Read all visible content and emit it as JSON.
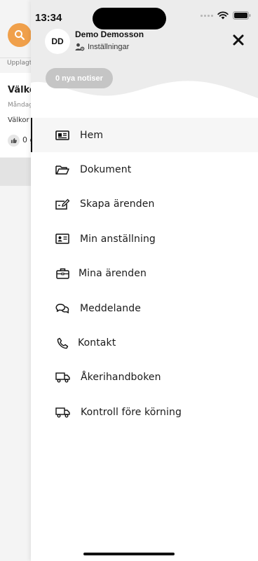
{
  "background": {
    "section_label": "Upplagt",
    "post_title": "Välko",
    "post_date": "Måndag",
    "post_text": "Välkor",
    "like_count": "0 g"
  },
  "status_bar": {
    "time": "13:34"
  },
  "drawer": {
    "avatar_initials": "DD",
    "user_name": "Demo Demosson",
    "settings_label": "Inställningar",
    "notifications_label": "0 nya notiser",
    "menu": [
      {
        "label": "Hem",
        "icon": "home-news-icon",
        "active": true
      },
      {
        "label": "Dokument",
        "icon": "folder-icon",
        "active": false
      },
      {
        "label": "Skapa ärenden",
        "icon": "edit-ticket-icon",
        "active": false
      },
      {
        "label": "Min anställning",
        "icon": "id-card-icon",
        "active": false
      },
      {
        "label": "Mina ärenden",
        "icon": "briefcase-icon",
        "active": false
      },
      {
        "label": "Meddelande",
        "icon": "chat-bubbles-icon",
        "active": false
      },
      {
        "label": "Kontakt",
        "icon": "phone-icon",
        "active": false
      },
      {
        "label": "Åkerihandboken",
        "icon": "truck-icon",
        "active": false
      },
      {
        "label": "Kontroll före körning",
        "icon": "truck-check-icon",
        "active": false
      }
    ]
  },
  "colors": {
    "accent_orange": "#f0a04b",
    "header_gray": "#eeeeee",
    "pill_gray": "#c5c5c5",
    "text_dark": "#1a1a1a"
  }
}
